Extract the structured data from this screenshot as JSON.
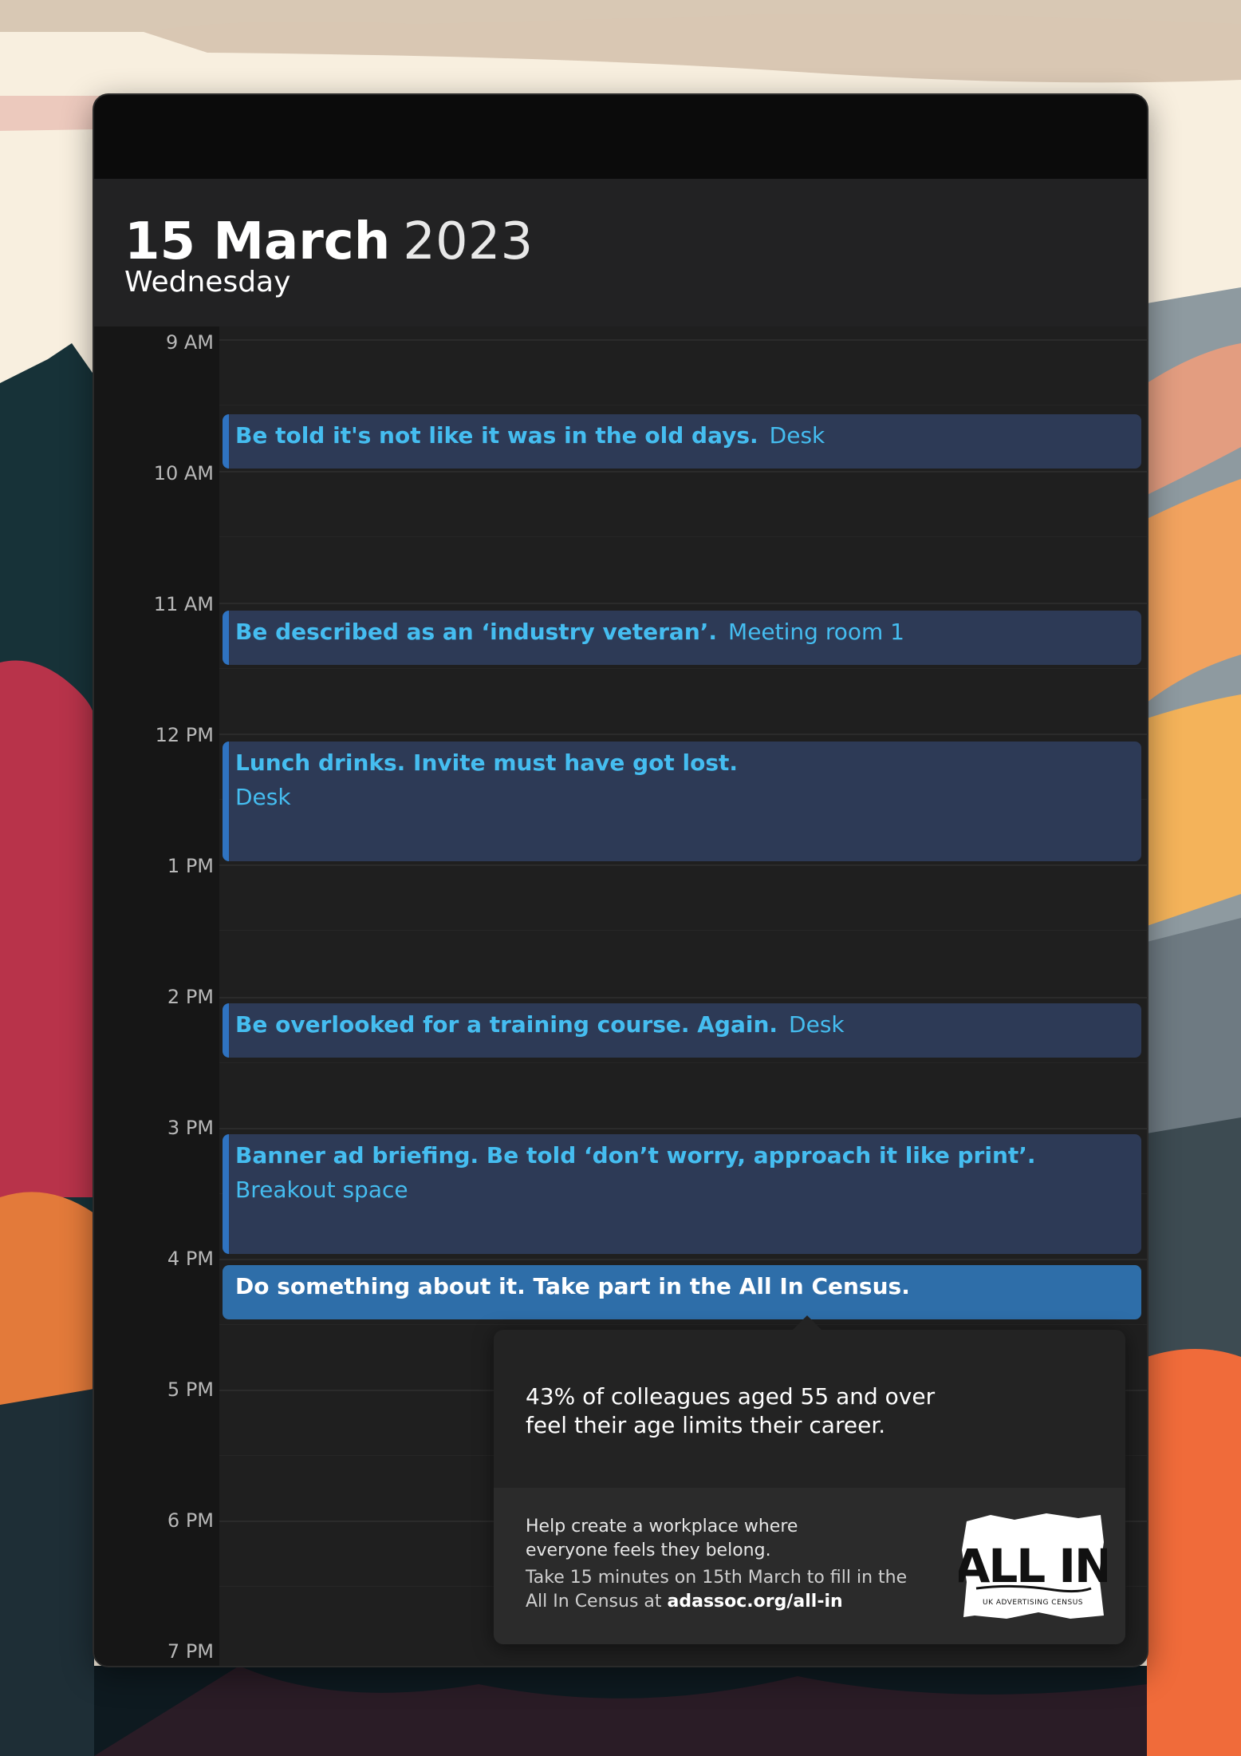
{
  "header": {
    "day_month": "15 March",
    "year": "2023",
    "weekday": "Wednesday"
  },
  "time_labels": [
    "9 AM",
    "10 AM",
    "11 AM",
    "12 PM",
    "1 PM",
    "2 PM",
    "3 PM",
    "4 PM",
    "5 PM",
    "6 PM",
    "7 PM"
  ],
  "events": [
    {
      "title": "Be told it's not like it was in the old days.",
      "location": "Desk"
    },
    {
      "title": "Be described as an ‘industry veteran’.",
      "location": "Meeting room 1"
    },
    {
      "title": "Lunch drinks. Invite must have got lost.",
      "location": "Desk"
    },
    {
      "title": "Be overlooked for a training course. Again.",
      "location": "Desk"
    },
    {
      "title": "Banner ad briefing. Be told ‘don’t worry, approach it like print’.",
      "location": "Breakout space"
    },
    {
      "title": "Do something about it. Take part in the All In Census.",
      "location": ""
    }
  ],
  "popover": {
    "stat": "43% of colleagues aged 55 and over feel their age limits their career.",
    "line1": "Help create a workplace where everyone feels they belong.",
    "line2": "Take 15 minutes on 15th March to fill in the All In Census at",
    "url": "adassoc.org/all-in",
    "logo_text": "ALL IN",
    "logo_sub": "UK ADVERTISING CENSUS"
  },
  "colors": {
    "event_bg": "#2d3a56",
    "event_accent": "#2f73c1",
    "event_text": "#45bdf0",
    "cta_bg": "#2e6ea9"
  }
}
